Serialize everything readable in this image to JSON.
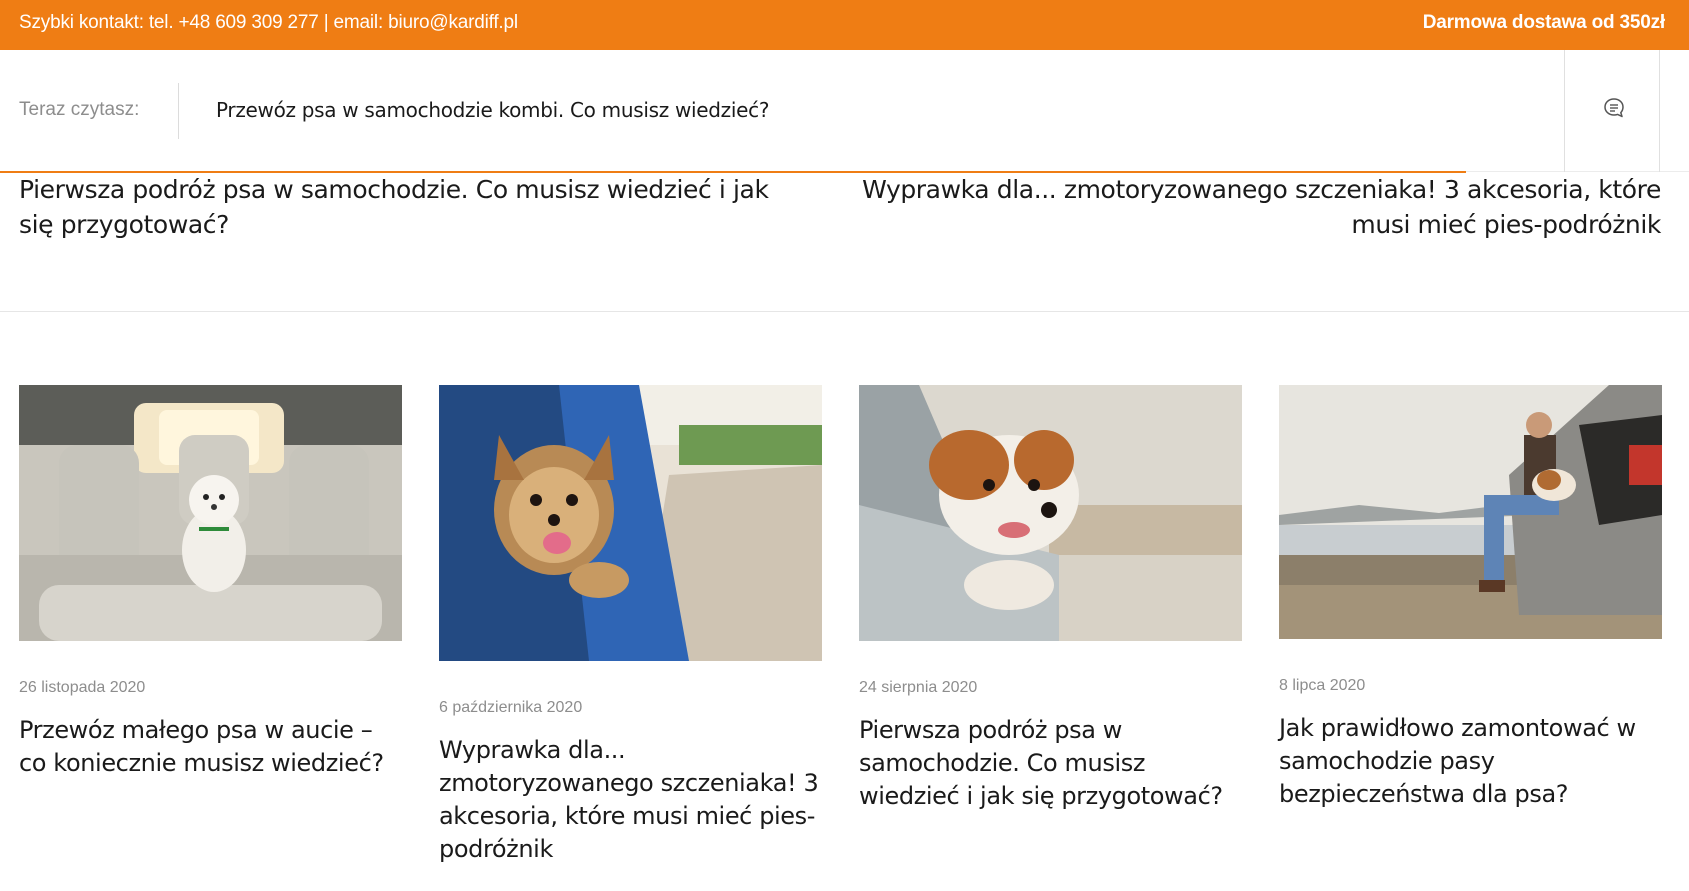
{
  "topbar": {
    "contact": "Szybki kontakt: tel. +48 609 309 277 | email: biuro@kardiff.pl",
    "shipping": "Darmowa dostawa od 350zł",
    "accent_color": "#ef7d14"
  },
  "reading_bar": {
    "label": "Teraz czytasz:",
    "current_title": "Przewóz psa w samochodzie kombi. Co musisz wiedzieć?",
    "comment_icon": "comment-icon"
  },
  "article_nav": {
    "prev_title": "Pierwsza podróż psa w samochodzie. Co musisz wiedzieć i jak się przygotować?",
    "next_title": "Wyprawka dla... zmotoryzowanego szczeniaka! 3 akcesoria, które musi mieć pies-podróżnik"
  },
  "related": [
    {
      "date": "26 listopada 2020",
      "title": "Przewóz małego psa w aucie – co koniecznie musisz wiedzieć?",
      "image": "white-dog-on-car-back-seat"
    },
    {
      "date": "6 października 2020",
      "title": "Wyprawka dla... zmotoryzowanego szczeniaka! 3 akcesoria, które musi mieć pies-podróżnik",
      "image": "yorkshire-terrier-in-car-window"
    },
    {
      "date": "24 sierpnia 2020",
      "title": "Pierwsza podróż psa w samochodzie. Co musisz wiedzieć i jak się przygotować?",
      "image": "jack-russell-in-car-window"
    },
    {
      "date": "8 lipca 2020",
      "title": "Jak prawidłowo zamontować w samochodzie pasy bezpieczeństwa dla psa?",
      "image": "man-and-beagle-in-car-trunk"
    }
  ]
}
